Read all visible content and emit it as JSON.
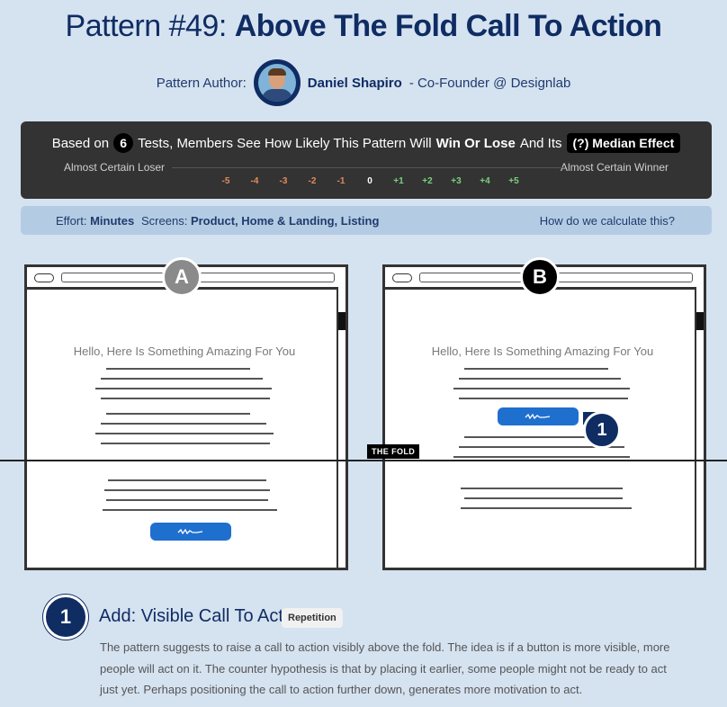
{
  "title": {
    "prefix": "Pattern #49:",
    "name": "Above The Fold Call To Action"
  },
  "author": {
    "label": "Pattern Author:",
    "name": "Daniel Shapiro",
    "role": "- Co-Founder @ Designlab"
  },
  "summary": {
    "based_on": "Based on",
    "count": "6",
    "tests_text": "Tests, Members See How Likely This Pattern Will",
    "win_lose": "Win Or Lose",
    "and_its": "And Its",
    "median_button": "(?) Median Effect",
    "scale_left": "Almost Certain Loser",
    "scale_right": "Almost Certain Winner",
    "ticks": [
      "-5",
      "-4",
      "-3",
      "-2",
      "-1",
      "0",
      "+1",
      "+2",
      "+3",
      "+4",
      "+5"
    ],
    "tick_colors": [
      "#e38a5e",
      "#e38a5e",
      "#e38a5e",
      "#e38a5e",
      "#e38a5e",
      "#ffffff",
      "#7cd07c",
      "#7cd07c",
      "#7cd07c",
      "#7cd07c",
      "#7cd07c"
    ]
  },
  "info": {
    "effort_label": "Effort:",
    "effort_value": "Minutes",
    "screens_label": "Screens:",
    "screens_value": "Product, Home & Landing, Listing",
    "how_link": "How do we calculate this?"
  },
  "variants": {
    "a_label": "A",
    "b_label": "B",
    "heading": "Hello, Here Is Something Amazing For You",
    "fold_label": "THE FOLD",
    "marker": "1"
  },
  "change": {
    "number": "1",
    "title": "Add: Visible Call To Action",
    "tag": "Repetition",
    "description": "The pattern suggests to raise a call to action visibly above the fold. The idea is if a button is more visible, more people will act on it. The counter hypothesis is that by placing it earlier, some people might not be ready to act just yet. Perhaps positioning the call to action further down, generates more motivation to act."
  },
  "colors": {
    "accent": "#0f2c63",
    "cta": "#1f6fcf",
    "background": "#d5e2f0"
  }
}
